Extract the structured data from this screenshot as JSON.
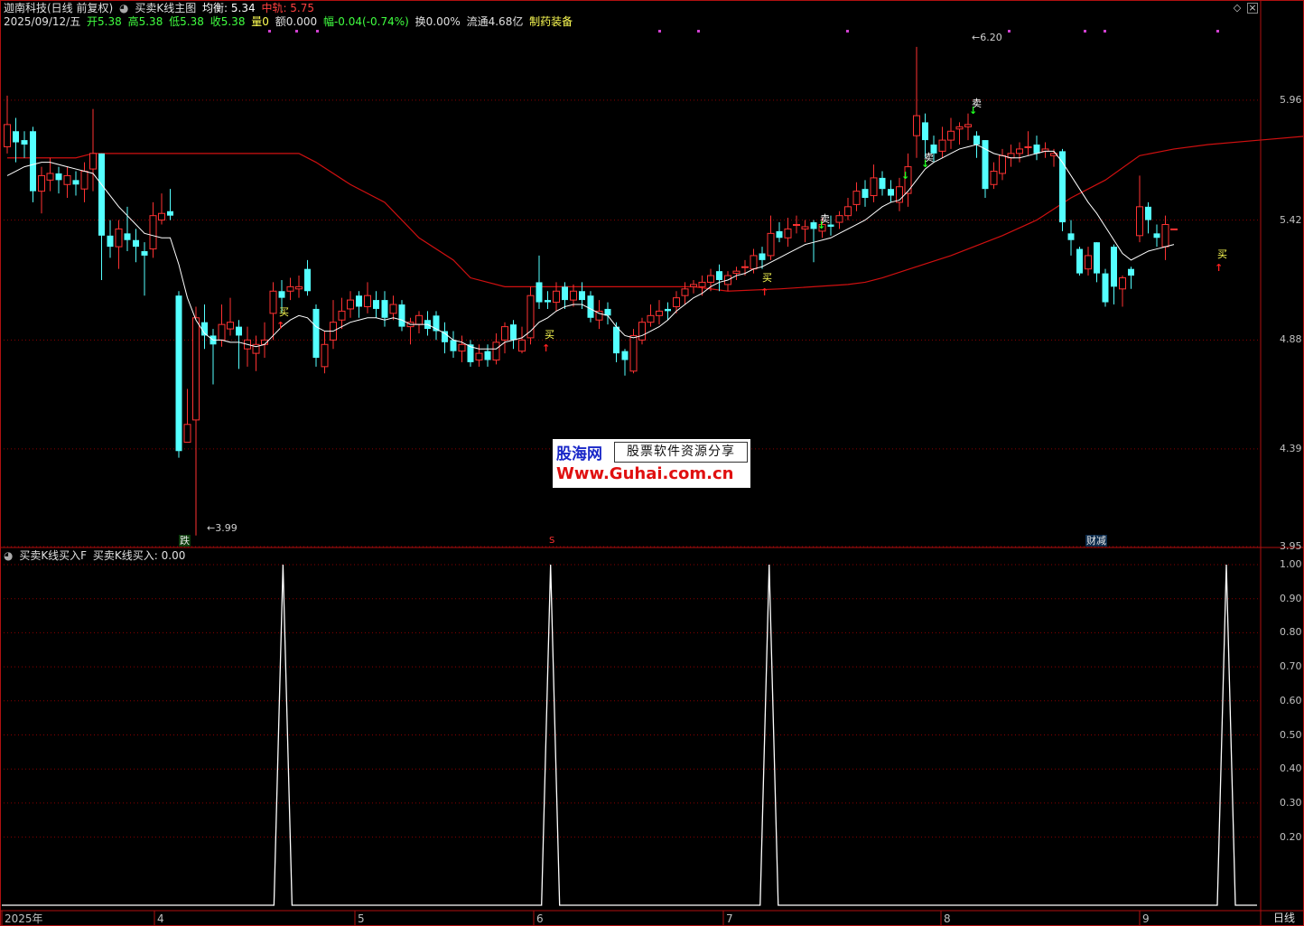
{
  "header": {
    "stock_name": "迦南科技(日线 前复权)",
    "indicator_name": "买卖K线主图",
    "avg_label": "均衡: 5.34",
    "mid_label": "中轨: 5.75",
    "date_label": "2025/09/12/五",
    "open_label": "开5.38",
    "high_label": "高5.38",
    "low_label": "低5.38",
    "close_label": "收5.38",
    "vol_label": "量0",
    "amount_label": "额0.000",
    "change_label": "幅-0.04(-0.74%)",
    "turnover_label": "换0.00%",
    "float_label": "流通4.68亿",
    "sector_label": "制药装备"
  },
  "sub_header": {
    "indicator_name": "买卖K线买入F",
    "value_label": "买卖K线买入: 0.00"
  },
  "main_axis": [
    "5.96",
    "5.42",
    "4.88",
    "4.39",
    "3.95"
  ],
  "sub_axis": [
    "1.00",
    "0.90",
    "0.80",
    "0.70",
    "0.60",
    "0.50",
    "0.40",
    "0.30",
    "0.20"
  ],
  "time_axis": [
    "2025年",
    "4",
    "5",
    "6",
    "7",
    "8",
    "9"
  ],
  "period_label": "日线",
  "annotations": {
    "high_price": "6.20",
    "low_price": "3.99",
    "buy": "买",
    "sell": "卖",
    "event_die": "跌",
    "event_s": "S",
    "event_caijian": "财减"
  },
  "watermark": {
    "brand": "股海网",
    "slogan": "股票软件资源分享",
    "url": "Www.Guhai.com.cn"
  },
  "colors": {
    "up": "#ff3232",
    "down": "#54ffff",
    "ma": "#ffffff",
    "band": "#d01010",
    "grid": "#8a0000",
    "axis_text": "#c0c0c0",
    "buy_label": "#ffff54",
    "sell_label": "#ffffff"
  },
  "chart_data": {
    "type": "candlestick",
    "ylim": [
      3.95,
      6.24
    ],
    "candles": [
      [
        5.75,
        5.85,
        5.98,
        5.72
      ],
      [
        5.82,
        5.77,
        5.88,
        5.68
      ],
      [
        5.78,
        5.76,
        5.82,
        5.7
      ],
      [
        5.82,
        5.55,
        5.84,
        5.5
      ],
      [
        5.55,
        5.62,
        5.66,
        5.45
      ],
      [
        5.6,
        5.63,
        5.7,
        5.55
      ],
      [
        5.63,
        5.6,
        5.66,
        5.54
      ],
      [
        5.58,
        5.62,
        5.66,
        5.52
      ],
      [
        5.6,
        5.58,
        5.64,
        5.53
      ],
      [
        5.56,
        5.64,
        5.68,
        5.5
      ],
      [
        5.65,
        5.72,
        5.92,
        5.55
      ],
      [
        5.72,
        5.35,
        5.72,
        5.15
      ],
      [
        5.35,
        5.3,
        5.42,
        5.25
      ],
      [
        5.3,
        5.38,
        5.42,
        5.2
      ],
      [
        5.36,
        5.33,
        5.48,
        5.28
      ],
      [
        5.33,
        5.3,
        5.38,
        5.23
      ],
      [
        5.28,
        5.26,
        5.32,
        5.08
      ],
      [
        5.29,
        5.44,
        5.5,
        5.25
      ],
      [
        5.42,
        5.45,
        5.54,
        5.4
      ],
      [
        5.46,
        5.44,
        5.56,
        5.42
      ],
      [
        5.08,
        4.38,
        5.1,
        4.35
      ],
      [
        4.42,
        4.5,
        4.66,
        4.42
      ],
      [
        4.52,
        4.98,
        5.03,
        4.0
      ],
      [
        4.96,
        4.9,
        5.04,
        4.84
      ],
      [
        4.9,
        4.86,
        4.93,
        4.68
      ],
      [
        4.88,
        4.95,
        5.04,
        4.85
      ],
      [
        4.93,
        4.96,
        5.07,
        4.9
      ],
      [
        4.94,
        4.9,
        4.97,
        4.75
      ],
      [
        4.84,
        4.88,
        4.94,
        4.76
      ],
      [
        4.82,
        4.86,
        4.9,
        4.74
      ],
      [
        4.86,
        4.88,
        4.96,
        4.8
      ],
      [
        5.0,
        5.1,
        5.14,
        4.88
      ],
      [
        5.1,
        5.07,
        5.15,
        5.0
      ],
      [
        5.1,
        5.12,
        5.16,
        5.06
      ],
      [
        5.11,
        5.12,
        5.17,
        5.07
      ],
      [
        5.2,
        5.1,
        5.24,
        5.08
      ],
      [
        5.02,
        4.8,
        5.04,
        4.76
      ],
      [
        4.76,
        4.86,
        4.92,
        4.73
      ],
      [
        4.88,
        4.96,
        5.06,
        4.84
      ],
      [
        4.97,
        5.01,
        5.07,
        4.93
      ],
      [
        5.02,
        5.06,
        5.1,
        4.98
      ],
      [
        5.08,
        5.03,
        5.1,
        4.98
      ],
      [
        5.03,
        5.08,
        5.14,
        5.0
      ],
      [
        5.06,
        5.02,
        5.1,
        4.98
      ],
      [
        5.06,
        4.98,
        5.1,
        4.94
      ],
      [
        5.0,
        5.04,
        5.08,
        4.97
      ],
      [
        5.04,
        4.94,
        5.06,
        4.92
      ],
      [
        4.94,
        4.96,
        4.98,
        4.86
      ],
      [
        4.95,
        4.99,
        5.01,
        4.91
      ],
      [
        4.97,
        4.93,
        5.01,
        4.9
      ],
      [
        4.99,
        4.92,
        5.01,
        4.88
      ],
      [
        4.92,
        4.87,
        4.96,
        4.82
      ],
      [
        4.88,
        4.83,
        4.92,
        4.8
      ],
      [
        4.83,
        4.86,
        4.9,
        4.78
      ],
      [
        4.86,
        4.78,
        4.88,
        4.76
      ],
      [
        4.79,
        4.82,
        4.86,
        4.76
      ],
      [
        4.83,
        4.79,
        4.86,
        4.76
      ],
      [
        4.79,
        4.87,
        4.91,
        4.77
      ],
      [
        4.88,
        4.94,
        4.96,
        4.82
      ],
      [
        4.95,
        4.88,
        4.97,
        4.84
      ],
      [
        4.83,
        4.88,
        4.94,
        4.82
      ],
      [
        4.89,
        5.08,
        5.12,
        4.86
      ],
      [
        5.14,
        5.05,
        5.26,
        5.02
      ],
      [
        5.06,
        5.05,
        5.1,
        5.02
      ],
      [
        5.05,
        5.1,
        5.14,
        5.01
      ],
      [
        5.12,
        5.06,
        5.14,
        5.02
      ],
      [
        5.06,
        5.1,
        5.13,
        5.03
      ],
      [
        5.1,
        5.06,
        5.14,
        5.02
      ],
      [
        5.08,
        4.98,
        5.1,
        4.96
      ],
      [
        4.97,
        5.01,
        5.06,
        4.93
      ],
      [
        5.02,
        4.99,
        5.05,
        4.95
      ],
      [
        4.94,
        4.82,
        4.96,
        4.78
      ],
      [
        4.83,
        4.79,
        4.84,
        4.72
      ],
      [
        4.74,
        4.9,
        4.93,
        4.73
      ],
      [
        4.88,
        4.96,
        4.98,
        4.86
      ],
      [
        4.96,
        4.99,
        5.04,
        4.94
      ],
      [
        4.99,
        5.01,
        5.06,
        4.95
      ],
      [
        5.02,
        5.01,
        5.05,
        4.97
      ],
      [
        5.03,
        5.07,
        5.1,
        5.0
      ],
      [
        5.08,
        5.11,
        5.14,
        5.04
      ],
      [
        5.12,
        5.13,
        5.15,
        5.09
      ],
      [
        5.12,
        5.14,
        5.17,
        5.08
      ],
      [
        5.14,
        5.17,
        5.2,
        5.1
      ],
      [
        5.19,
        5.15,
        5.22,
        5.1
      ],
      [
        5.13,
        5.17,
        5.19,
        5.1
      ],
      [
        5.18,
        5.19,
        5.21,
        5.15
      ],
      [
        5.21,
        5.21,
        5.24,
        5.17
      ],
      [
        5.2,
        5.26,
        5.29,
        5.18
      ],
      [
        5.27,
        5.24,
        5.3,
        5.2
      ],
      [
        5.26,
        5.36,
        5.44,
        5.24
      ],
      [
        5.37,
        5.34,
        5.41,
        5.32
      ],
      [
        5.34,
        5.38,
        5.43,
        5.3
      ],
      [
        5.4,
        5.4,
        5.44,
        5.36
      ],
      [
        5.38,
        5.39,
        5.42,
        5.32
      ],
      [
        5.41,
        5.38,
        5.42,
        5.23
      ],
      [
        5.37,
        5.4,
        5.43,
        5.34
      ],
      [
        5.4,
        5.39,
        5.44,
        5.35
      ],
      [
        5.41,
        5.44,
        5.46,
        5.38
      ],
      [
        5.44,
        5.48,
        5.52,
        5.42
      ],
      [
        5.49,
        5.55,
        5.59,
        5.46
      ],
      [
        5.56,
        5.52,
        5.6,
        5.48
      ],
      [
        5.53,
        5.61,
        5.67,
        5.5
      ],
      [
        5.61,
        5.56,
        5.64,
        5.53
      ],
      [
        5.56,
        5.53,
        5.6,
        5.5
      ],
      [
        5.5,
        5.57,
        5.61,
        5.46
      ],
      [
        5.54,
        5.66,
        5.72,
        5.48
      ],
      [
        5.8,
        5.89,
        6.2,
        5.7
      ],
      [
        5.86,
        5.78,
        5.9,
        5.7
      ],
      [
        5.76,
        5.72,
        5.8,
        5.68
      ],
      [
        5.73,
        5.78,
        5.84,
        5.7
      ],
      [
        5.78,
        5.82,
        5.88,
        5.74
      ],
      [
        5.83,
        5.84,
        5.86,
        5.76
      ],
      [
        5.84,
        5.85,
        5.9,
        5.78
      ],
      [
        5.8,
        5.76,
        5.82,
        5.7
      ],
      [
        5.78,
        5.56,
        5.78,
        5.52
      ],
      [
        5.58,
        5.64,
        5.68,
        5.56
      ],
      [
        5.63,
        5.71,
        5.74,
        5.6
      ],
      [
        5.7,
        5.72,
        5.76,
        5.66
      ],
      [
        5.72,
        5.74,
        5.77,
        5.68
      ],
      [
        5.75,
        5.75,
        5.82,
        5.71
      ],
      [
        5.76,
        5.72,
        5.8,
        5.69
      ],
      [
        5.73,
        5.74,
        5.77,
        5.7
      ],
      [
        5.71,
        5.72,
        5.74,
        5.66
      ],
      [
        5.73,
        5.41,
        5.74,
        5.37
      ],
      [
        5.36,
        5.33,
        5.42,
        5.26
      ],
      [
        5.29,
        5.18,
        5.3,
        5.17
      ],
      [
        5.2,
        5.26,
        5.3,
        5.17
      ],
      [
        5.32,
        5.18,
        5.32,
        5.14
      ],
      [
        5.18,
        5.05,
        5.2,
        5.03
      ],
      [
        5.3,
        5.12,
        5.31,
        5.04
      ],
      [
        5.11,
        5.16,
        5.17,
        5.03
      ],
      [
        5.2,
        5.17,
        5.21,
        5.11
      ],
      [
        5.35,
        5.48,
        5.62,
        5.32
      ],
      [
        5.48,
        5.42,
        5.5,
        5.36
      ],
      [
        5.36,
        5.34,
        5.4,
        5.3
      ],
      [
        5.3,
        5.4,
        5.44,
        5.24
      ],
      [
        5.38,
        5.38,
        5.38,
        5.38
      ]
    ],
    "ma": [
      5.62,
      5.64,
      5.66,
      5.67,
      5.68,
      5.68,
      5.67,
      5.66,
      5.65,
      5.64,
      5.63,
      5.58,
      5.53,
      5.48,
      5.44,
      5.4,
      5.36,
      5.35,
      5.34,
      5.34,
      5.22,
      5.07,
      4.97,
      4.91,
      4.88,
      4.88,
      4.87,
      4.87,
      4.86,
      4.85,
      4.86,
      4.9,
      4.94,
      4.97,
      4.99,
      4.98,
      4.94,
      4.92,
      4.92,
      4.94,
      4.96,
      4.97,
      4.98,
      4.98,
      4.97,
      4.98,
      4.97,
      4.95,
      4.95,
      4.95,
      4.93,
      4.91,
      4.88,
      4.87,
      4.85,
      4.84,
      4.84,
      4.84,
      4.87,
      4.88,
      4.89,
      4.92,
      4.96,
      4.98,
      5.01,
      5.03,
      5.04,
      5.04,
      5.02,
      5.0,
      4.99,
      4.94,
      4.9,
      4.89,
      4.9,
      4.92,
      4.94,
      4.97,
      5.01,
      5.04,
      5.07,
      5.09,
      5.12,
      5.14,
      5.15,
      5.17,
      5.18,
      5.2,
      5.21,
      5.23,
      5.25,
      5.27,
      5.29,
      5.31,
      5.32,
      5.33,
      5.34,
      5.36,
      5.38,
      5.4,
      5.42,
      5.45,
      5.48,
      5.5,
      5.51,
      5.55,
      5.6,
      5.65,
      5.68,
      5.7,
      5.72,
      5.74,
      5.75,
      5.76,
      5.74,
      5.72,
      5.71,
      5.7,
      5.7,
      5.71,
      5.72,
      5.73,
      5.73,
      5.68,
      5.62,
      5.56,
      5.5,
      5.45,
      5.39,
      5.33,
      5.27,
      5.24,
      5.26,
      5.28,
      5.29,
      5.3,
      5.31
    ],
    "band": [
      [
        0,
        5.7
      ],
      [
        8,
        5.7
      ],
      [
        10,
        5.72
      ],
      [
        34,
        5.72
      ],
      [
        36,
        5.68
      ],
      [
        40,
        5.58
      ],
      [
        44,
        5.5
      ],
      [
        48,
        5.34
      ],
      [
        52,
        5.24
      ],
      [
        54,
        5.16
      ],
      [
        58,
        5.12
      ],
      [
        80,
        5.12
      ],
      [
        84,
        5.1
      ],
      [
        90,
        5.11
      ],
      [
        98,
        5.13
      ],
      [
        100,
        5.14
      ],
      [
        102,
        5.16
      ],
      [
        106,
        5.21
      ],
      [
        110,
        5.26
      ],
      [
        116,
        5.35
      ],
      [
        120,
        5.42
      ],
      [
        124,
        5.52
      ],
      [
        128,
        5.6
      ],
      [
        132,
        5.71
      ],
      [
        136,
        5.74
      ],
      [
        140,
        5.76
      ],
      [
        152,
        5.8
      ],
      [
        162,
        5.8
      ],
      [
        170,
        5.8
      ],
      [
        175,
        5.77
      ],
      [
        178,
        5.75
      ]
    ]
  },
  "sub_chart": {
    "type": "line",
    "ylim": [
      0,
      1.0
    ],
    "spikes": [
      0.31,
      0.605,
      0.846,
      1.35
    ]
  }
}
